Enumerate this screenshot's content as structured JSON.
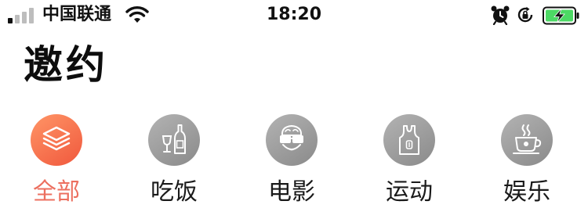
{
  "status_bar": {
    "carrier": "中国联通",
    "time": "18:20",
    "icons": [
      "signal-icon",
      "wifi-icon",
      "alarm-icon",
      "rotation-lock-icon",
      "battery-charging-icon"
    ]
  },
  "header": {
    "title": "邀约"
  },
  "categories": {
    "selected": "全部",
    "items": [
      {
        "label": "全部",
        "icon": "layers-icon",
        "active": true
      },
      {
        "label": "吃饭",
        "icon": "wine-icon",
        "active": false
      },
      {
        "label": "电影",
        "icon": "3d-glasses-icon",
        "active": false
      },
      {
        "label": "运动",
        "icon": "jersey-icon",
        "active": false
      },
      {
        "label": "娱乐",
        "icon": "coffee-cup-icon",
        "active": false
      }
    ]
  },
  "colors": {
    "active_gradient_start": "#ff9566",
    "active_gradient_end": "#f0583d",
    "active_label": "#ec6f5f",
    "inactive_circle": "#a0a0a0",
    "battery_fill": "#4cd964"
  }
}
